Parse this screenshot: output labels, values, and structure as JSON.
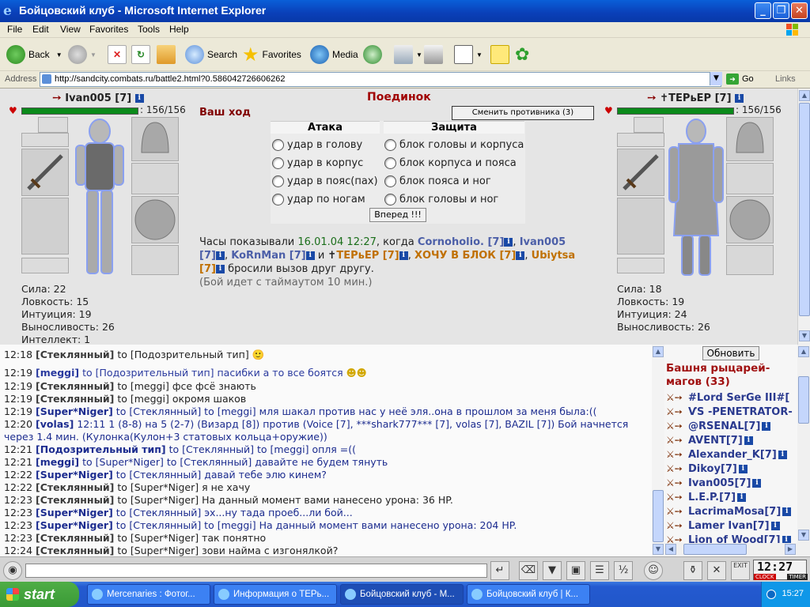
{
  "window": {
    "title": "Бойцовский клуб - Microsoft Internet Explorer",
    "controls": {
      "minimize": "_",
      "maximize": "❐",
      "close": "✕"
    }
  },
  "menu": [
    "File",
    "Edit",
    "View",
    "Favorites",
    "Tools",
    "Help"
  ],
  "toolbar": {
    "back": "Back",
    "search": "Search",
    "favorites": "Favorites",
    "media": "Media"
  },
  "address": {
    "label": "Address",
    "url": "http://sandcity.combats.ru/battle2.html?0.586042726606262",
    "go": "Go",
    "links": "Links"
  },
  "battle": {
    "title": "Поединок",
    "your_turn": "Ваш ход",
    "change_opponent": "Сменить противника (3)",
    "attack_header": "Атака",
    "defense_header": "Защита",
    "attack_options": [
      "удар в голову",
      "удар в корпус",
      "удар в пояс(пах)",
      "удар по ногам"
    ],
    "defense_options": [
      "блок головы и корпуса",
      "блок корпуса и пояса",
      "блок пояса и ног",
      "блок головы и ног"
    ],
    "forward": "Вперед !!!",
    "log": {
      "prefix": "Часы показывали",
      "time": "16.01.04 12:27",
      "when": ", когда",
      "p1": "Cornoholio. [7]",
      "p2": "Ivan005",
      "p2b": "[7]",
      "p3": "KoRnMan [7]",
      "and": "и",
      "p4": "ТЕРьЕР [7]",
      "p5": "ХОЧУ В БЛОК [7]",
      "p6": "Ubiytsa",
      "p6b": "[7]",
      "tail": "бросили вызов друг другу.",
      "note": "(Бой идет с таймаутом 10 мин.)",
      "comma": ","
    },
    "left": {
      "name": "Ivan005",
      "level": "[7]",
      "hp": ": 156/156",
      "hp_fraction": 1.0,
      "stats": [
        "Сила: 22",
        "Ловкость: 15",
        "Интуиция: 19",
        "Выносливость: 26",
        "Интеллект: 1"
      ]
    },
    "right": {
      "name": "ТЕРьЕР",
      "level": "[7]",
      "hp": ": 156/156",
      "hp_fraction": 1.0,
      "stats": [
        "Сила: 18",
        "Ловкость: 19",
        "Интуиция: 24",
        "Выносливость: 26"
      ]
    }
  },
  "chat": {
    "to": "to",
    "lines": [
      {
        "time": "12:18",
        "from": "[Стеклянный]",
        "target": "[Подозрительный тип]",
        "text": ""
      },
      {
        "time": "12:19",
        "from": "[meggi]",
        "target": "[Подозрительный тип]",
        "text": "пасибки а то все боятся"
      },
      {
        "time": "12:19",
        "from": "[Стеклянный]",
        "target": "[meggi]",
        "text": "фсе фсё знають"
      },
      {
        "time": "12:19",
        "from": "[Стеклянный]",
        "target": "[meggi]",
        "text": "окромя шаков"
      },
      {
        "time": "12:19",
        "from": "[Super*Niger]",
        "target": "[Стеклянный] to [meggi]",
        "text": "мля шакал против нас у неё эля..она в прошлом за меня была:(("
      },
      {
        "time": "12:20",
        "from": "[volas]",
        "target": "",
        "text": "12:11 1 (8-8) на 5 (2-7) (Визард [8]) против (Voice [7], ***shark777*** [7], volas [7], BAZIL [7]) Бой начнется через 1.4 мин. (Кулонка(Кулон+3 статовых кольца+оружие))"
      },
      {
        "time": "12:21",
        "from": "[Подозрительный тип]",
        "target": "[Стеклянный] to [meggi]",
        "text": "опля =(("
      },
      {
        "time": "12:21",
        "from": "[meggi]",
        "target": "[Super*Niger] to [Стеклянный]",
        "text": "давайте не будем тянуть"
      },
      {
        "time": "12:22",
        "from": "[Super*Niger]",
        "target": "[Стеклянный]",
        "text": "давай тебе элю кинем?"
      },
      {
        "time": "12:22",
        "from": "[Стеклянный]",
        "target": "[Super*Niger]",
        "text": "я не хачу"
      },
      {
        "time": "12:23",
        "from": "[Стеклянный]",
        "target": "[Super*Niger]",
        "text": "На данный момент вами нанесено урона: 36 HP."
      },
      {
        "time": "12:23",
        "from": "[Super*Niger]",
        "target": "[Стеклянный]",
        "text": "эх...ну тада проеб...ли бой..."
      },
      {
        "time": "12:23",
        "from": "[Super*Niger]",
        "target": "[Стеклянный] to [meggi]",
        "text": "На данный момент вами нанесено урона: 204 HP."
      },
      {
        "time": "12:23",
        "from": "[Стеклянный]",
        "target": "[Super*Niger]",
        "text": "так понятно"
      },
      {
        "time": "12:24",
        "from": "[Стеклянный]",
        "target": "[Super*Niger]",
        "text": "зови найма с изгонялкой?"
      }
    ]
  },
  "online": {
    "refresh": "Обновить",
    "room": "Башня рыцарей-магов (33)",
    "users": [
      "#Lord SerGe III#[",
      "ѴS -PENETRATOR-",
      "@RSENAL[7]",
      "AVENT[7]",
      "Alexander_K[7]",
      "Dikoy[7]",
      "Ivan005[7]",
      "L.E.P.[7]",
      "LacrimaMosa[7]",
      "Lamer Ivan[7]",
      "Lion of Wood[7]"
    ]
  },
  "clock": {
    "time": "12:27",
    "label_clock": "CLOCK",
    "label_timer": "TIMER",
    "exit": "EXIT"
  },
  "taskbar": {
    "start": "start",
    "tasks": [
      "Mercenaries : Фотог...",
      "Информация о ТЕРь...",
      "Бойцовский клуб - M...",
      "Бойцовский клуб | К..."
    ],
    "tray_time": "15:27"
  }
}
